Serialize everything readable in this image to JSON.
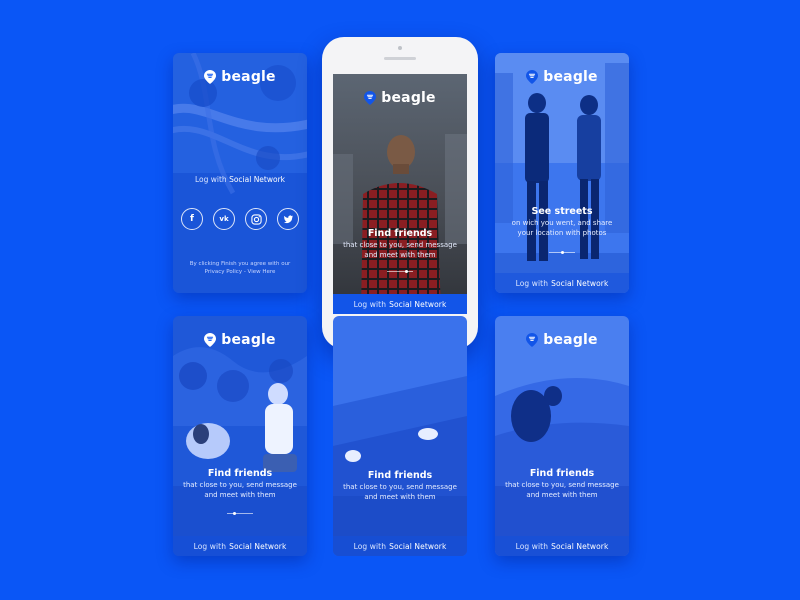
{
  "brand": "beagle",
  "login_prefix": "Log with",
  "login_link": "Social Network",
  "terms": "By clicking Finish you agree with our Privacy Policy - View Here",
  "social": {
    "facebook_glyph": "f",
    "vk_glyph": "vk",
    "instagram_icon": "instagram-icon",
    "twitter_icon": "twitter-icon"
  },
  "screens": {
    "find_friends": {
      "title": "Find friends",
      "subtitle": "that close to you, send message and meet with them"
    },
    "see_streets": {
      "title": "See streets",
      "subtitle": "on wich you went, and share your location with photos"
    }
  },
  "colors": {
    "background": "#0a56f6",
    "accent": "#1255e8"
  }
}
